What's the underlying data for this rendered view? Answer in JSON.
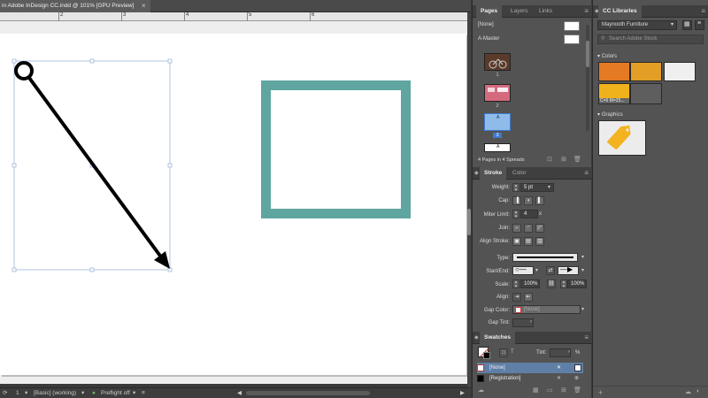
{
  "document": {
    "tab_title": "in Adobe InDesign CC.indd @ 101% [GPU Preview]",
    "close_glyph": "×",
    "ruler_labels": [
      "2",
      "3",
      "4",
      "5",
      "6"
    ],
    "accent_rect_color": "#5fa5a0",
    "arrow_color": "#000000"
  },
  "statusbar": {
    "page_number": "1",
    "style": "[Basic] (working)",
    "preflight": "Preflight off"
  },
  "pages_panel": {
    "tabs": [
      "Pages",
      "Layers",
      "Links"
    ],
    "none_label": "[None]",
    "master_label": "A-Master",
    "page_numbers": [
      "1",
      "2",
      "3"
    ],
    "master_prefix": "A",
    "footer": "4 Pages in 4 Spreads"
  },
  "stroke_panel": {
    "tabs": [
      "Stroke",
      "Color"
    ],
    "weight_label": "Weight:",
    "weight_value": "5 pt",
    "cap_label": "Cap:",
    "miter_label": "Miter Limit:",
    "miter_value": "4",
    "miter_suffix": "x",
    "join_label": "Join:",
    "align_stroke_label": "Align Stroke:",
    "type_label": "Type:",
    "start_end_label": "Start/End:",
    "scale_label": "Scale:",
    "scale_start": "100%",
    "scale_end": "100%",
    "align_label": "Align:",
    "gap_color_label": "Gap Color:",
    "gap_color_value": "[None]",
    "gap_tint_label": "Gap Tint:"
  },
  "swatches_panel": {
    "tab": "Swatches",
    "tint_label": "Tint:",
    "tint_unit": "%",
    "rows": [
      {
        "name": "[None]",
        "selected": true,
        "chip": "none"
      },
      {
        "name": "[Registration]",
        "selected": false,
        "chip": "#000000"
      }
    ]
  },
  "cc_libraries": {
    "tab": "CC Libraries",
    "library": "Maynooth Furniture",
    "search_placeholder": "Search Adobe Stock",
    "colors_section": "Colors",
    "graphics_section": "Graphics",
    "color_swatches": [
      "#e47a24",
      "#e39e26",
      "#efefef",
      "#f0b21c",
      "#5e5e5e"
    ],
    "color_caption": "C=6 M=25..."
  },
  "icons": [
    "close-icon",
    "menu-icon",
    "search-icon",
    "plus-icon",
    "trash-icon",
    "new-page-icon",
    "grid-view-icon",
    "list-view-icon",
    "cc-sync-icon"
  ]
}
